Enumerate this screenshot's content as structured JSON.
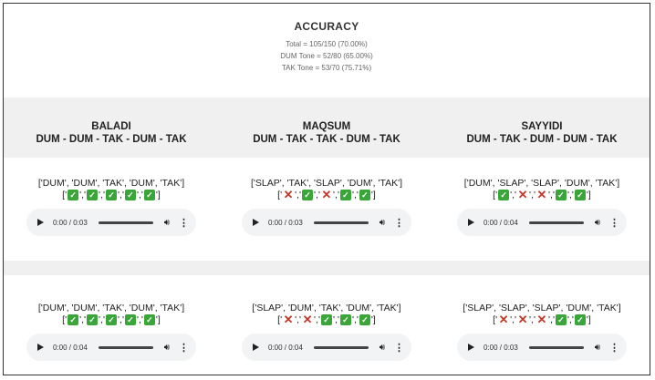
{
  "summary": {
    "title": "ACCURACY",
    "total": "Total = 105/150 (70.00%)",
    "dum": "DUM Tone = 52/80 (65.00%)",
    "tak": "TAK Tone = 53/70 (75.71%)"
  },
  "columns": [
    {
      "name": "BALADI",
      "pattern": "DUM - DUM - TAK - DUM - TAK"
    },
    {
      "name": "MAQSUM",
      "pattern": "DUM - TAK - TAK - DUM - TAK"
    },
    {
      "name": "SAYYIDI",
      "pattern": "DUM - TAK - DUM - DUM - TAK"
    }
  ],
  "rows": [
    [
      {
        "seq": "['DUM', 'DUM', 'TAK', 'DUM', 'TAK']",
        "marks": [
          "ok",
          "ok",
          "ok",
          "ok",
          "ok"
        ],
        "time": "0:00 / 0:03"
      },
      {
        "seq": "['SLAP', 'TAK', 'SLAP', 'DUM', 'TAK']",
        "marks": [
          "bad",
          "ok",
          "bad",
          "ok",
          "ok"
        ],
        "time": "0:00 / 0:03"
      },
      {
        "seq": "['DUM', 'SLAP', 'SLAP', 'DUM', 'TAK']",
        "marks": [
          "ok",
          "bad",
          "bad",
          "ok",
          "ok"
        ],
        "time": "0:00 / 0:04"
      }
    ],
    [
      {
        "seq": "['DUM', 'DUM', 'TAK', 'DUM', 'TAK']",
        "marks": [
          "ok",
          "ok",
          "ok",
          "ok",
          "ok"
        ],
        "time": "0:00 / 0:04"
      },
      {
        "seq": "['SLAP', 'DUM', 'TAK', 'DUM', 'TAK']",
        "marks": [
          "bad",
          "bad",
          "ok",
          "ok",
          "ok"
        ],
        "time": "0:00 / 0:04"
      },
      {
        "seq": "['SLAP', 'SLAP', 'SLAP', 'DUM', 'TAK']",
        "marks": [
          "bad",
          "bad",
          "bad",
          "ok",
          "ok"
        ],
        "time": "0:00 / 0:03"
      }
    ]
  ],
  "glyphs": {
    "ok": "✓",
    "bad": "✕",
    "play_icon": "play-icon",
    "volume_icon": "volume-icon",
    "more_icon": "more-vert-icon"
  },
  "colors": {
    "ok": "#3aa63a",
    "bad": "#c0392b",
    "band": "#f0f0f0",
    "player": "#f1f3f4"
  }
}
